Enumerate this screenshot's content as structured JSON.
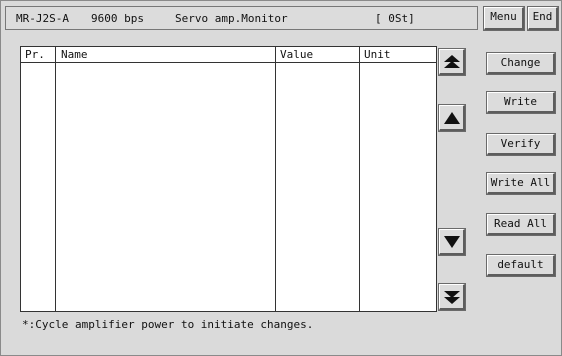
{
  "status": {
    "model": "MR-J2S-A",
    "baud": "9600 bps",
    "mode": "Servo amp.Monitor",
    "state": "[ 0St]"
  },
  "header_buttons": {
    "menu": "Menu",
    "end": "End"
  },
  "table": {
    "columns": [
      "Pr.",
      "Name",
      "Value",
      "Unit"
    ],
    "rows": []
  },
  "side_buttons": {
    "change": "Change",
    "write": "Write",
    "verify": "Verify",
    "write_all": "Write All",
    "read_all": "Read All",
    "default": "default"
  },
  "scroll_icons": {
    "page_up": "double-up-arrow-icon",
    "line_up": "up-arrow-icon",
    "line_down": "down-arrow-icon",
    "page_down": "double-down-arrow-icon"
  },
  "footer": {
    "note": "*:Cycle amplifier power to initiate changes."
  }
}
